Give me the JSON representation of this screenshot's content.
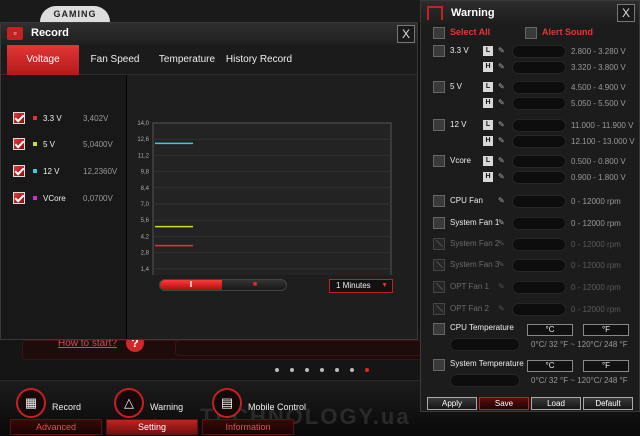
{
  "background_app": {
    "logo": "GAMING",
    "howto_link": "How to start?",
    "howto_icon": "?",
    "pager_dots": 7,
    "active_dot": 6,
    "watermark": "TECHNOLOGY.ua",
    "nav": [
      {
        "label": "Record",
        "icon": "record-icon"
      },
      {
        "label": "Warning",
        "icon": "warning-icon"
      },
      {
        "label": "Mobile Control",
        "icon": "mobile-control-icon"
      }
    ],
    "bottom_tabs": [
      {
        "label": "Advanced",
        "selected": false
      },
      {
        "label": "Setting",
        "selected": true
      },
      {
        "label": "Information",
        "selected": false
      }
    ]
  },
  "record": {
    "title": "Record",
    "close": "X",
    "tabs": [
      "Voltage",
      "Fan Speed",
      "Temperature",
      "History Record"
    ],
    "selected_tab": 0,
    "legend": [
      {
        "name": "3.3 V",
        "value": "3,402V",
        "color": "#e8303a"
      },
      {
        "name": "5 V",
        "value": "5,0400V",
        "color": "#c8e02a"
      },
      {
        "name": "12 V",
        "value": "12,2360V",
        "color": "#30d0e0"
      },
      {
        "name": "VCore",
        "value": "0,0700V",
        "color": "#d030d0"
      }
    ],
    "pause_icon": "‖",
    "stop_icon": "■",
    "time_range": "1 Minutes",
    "time_arrow": "▼"
  },
  "chart_data": {
    "type": "line",
    "title": "",
    "xlabel": "",
    "ylabel": "",
    "y_unit_label": "(V)",
    "ylim": [
      0,
      14
    ],
    "yticks": [
      "14,0",
      "12,6",
      "11,2",
      "9,8",
      "8,4",
      "7,0",
      "5,6",
      "4,2",
      "2,8",
      "1,4",
      "(V)"
    ],
    "grid": true,
    "series": [
      {
        "name": "12 V",
        "values": [
          12.236
        ],
        "color": "#30d0e0"
      },
      {
        "name": "5 V",
        "values": [
          5.04
        ],
        "color": "#c8e02a"
      },
      {
        "name": "3.3 V",
        "values": [
          3.402
        ],
        "color": "#e8303a"
      },
      {
        "name": "VCore",
        "values": [
          0.07
        ],
        "color": "#d030d0"
      }
    ]
  },
  "warning": {
    "title": "Warning",
    "close": "X",
    "select_all": "Select All",
    "alert_sound": "Alert Sound",
    "voltages": [
      {
        "name": "3.3 V",
        "low": "2.800 - 3.280 V",
        "high": "3.320 - 3.800 V"
      },
      {
        "name": "5 V",
        "low": "4.500 - 4.900 V",
        "high": "5.050 - 5.500 V"
      },
      {
        "name": "12 V",
        "low": "11.000 - 11.900 V",
        "high": "12.100 - 13.000 V"
      },
      {
        "name": "Vcore",
        "low": "0.500 - 0.800 V",
        "high": "0.900 - 1.800 V"
      }
    ],
    "L": "L",
    "H": "H",
    "fans": [
      {
        "name": "CPU Fan",
        "range": "0 - 12000 rpm",
        "enabled": true
      },
      {
        "name": "System Fan 1",
        "range": "0 - 12000 rpm",
        "enabled": true
      },
      {
        "name": "System Fan 2",
        "range": "0 - 12000 rpm",
        "enabled": false
      },
      {
        "name": "System Fan 3",
        "range": "0 - 12000 rpm",
        "enabled": false
      },
      {
        "name": "OPT Fan 1",
        "range": "0 - 12000 rpm",
        "enabled": false
      },
      {
        "name": "OPT Fan 2",
        "range": "0 - 12000 rpm",
        "enabled": false
      }
    ],
    "temps": [
      {
        "name": "CPU Temperature",
        "celsius": "°C",
        "fahrenheit": "°F",
        "range": "0°C/ 32 °F ~ 120°C/ 248 °F"
      },
      {
        "name": "System Temperature",
        "celsius": "°C",
        "fahrenheit": "°F",
        "range": "0°C/ 32 °F ~ 120°C/ 248 °F"
      }
    ],
    "buttons": {
      "apply": "Apply",
      "save": "Save",
      "load": "Load",
      "default": "Default"
    },
    "pen_icon": "✎"
  }
}
